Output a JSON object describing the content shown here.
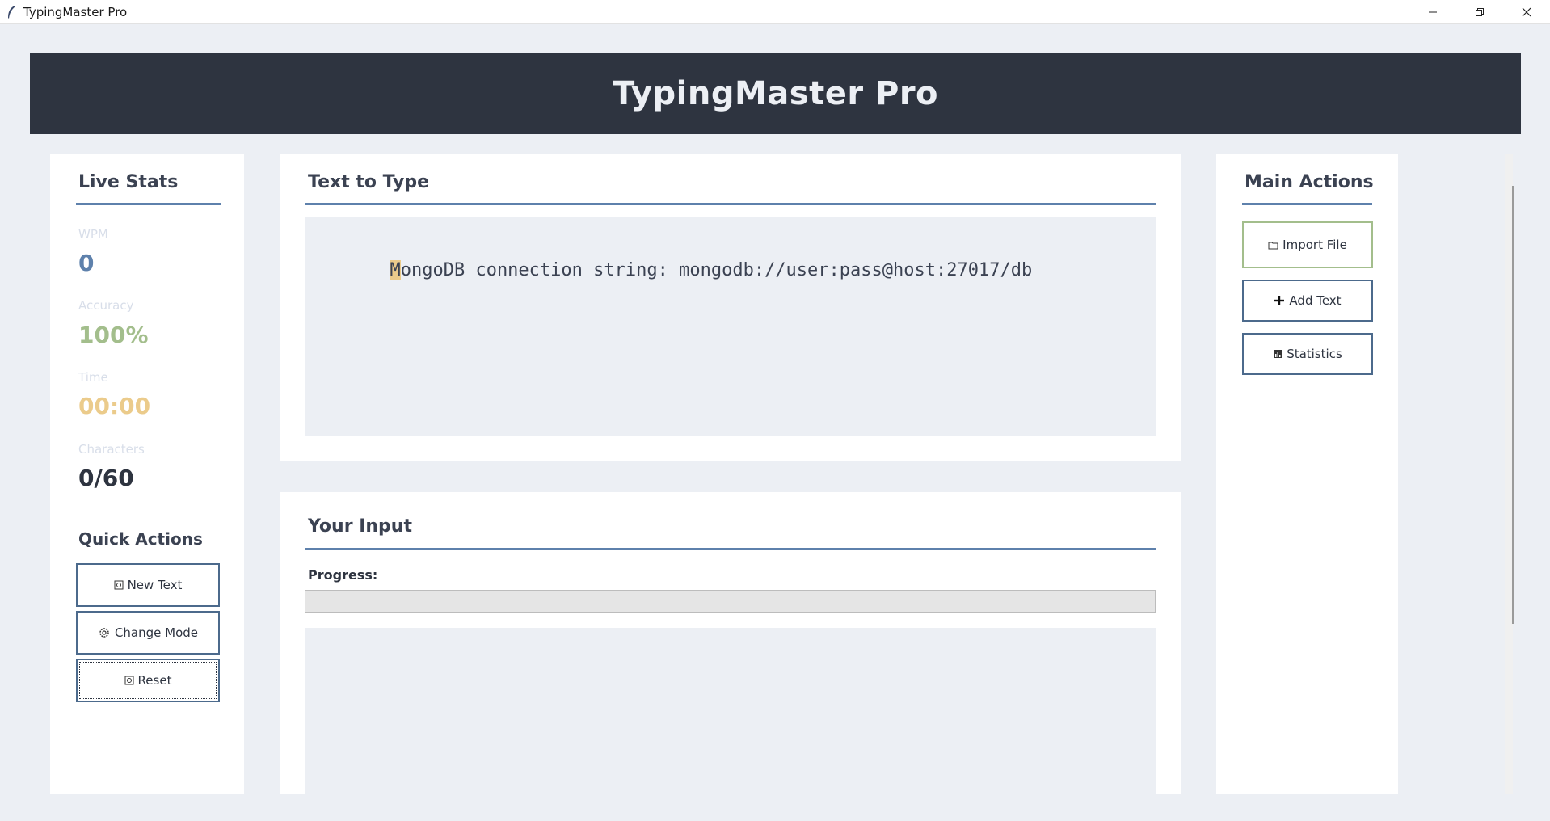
{
  "window": {
    "title": "TypingMaster Pro",
    "icons": {
      "app": "feather-icon",
      "minimize": "minimize-icon",
      "maximize": "restore-icon",
      "close": "close-icon"
    }
  },
  "header": {
    "title": "TypingMaster Pro"
  },
  "stats": {
    "heading": "Live Stats",
    "wpm_label": "WPM",
    "wpm_value": "0",
    "accuracy_label": "Accuracy",
    "accuracy_value": "100%",
    "time_label": "Time",
    "time_value": "00:00",
    "characters_label": "Characters",
    "characters_value": "0/60",
    "colors": {
      "wpm": "#5e81ac",
      "accuracy": "#a3be8c",
      "time": "#ebcb8b",
      "characters": "#2e3440"
    }
  },
  "quick_actions": {
    "heading": "Quick Actions",
    "new_text": "New Text",
    "change_mode": "Change Mode",
    "reset": "Reset"
  },
  "text_to_type": {
    "heading": "Text to Type",
    "current_char": "M",
    "remaining": "ongoDB connection string: mongodb://user:pass@host:27017/db"
  },
  "input": {
    "heading": "Your Input",
    "progress_label": "Progress:",
    "progress_value": 0,
    "value": ""
  },
  "main_actions": {
    "heading": "Main Actions",
    "import_file": "Import File",
    "add_text": "Add Text",
    "statistics": "Statistics"
  }
}
